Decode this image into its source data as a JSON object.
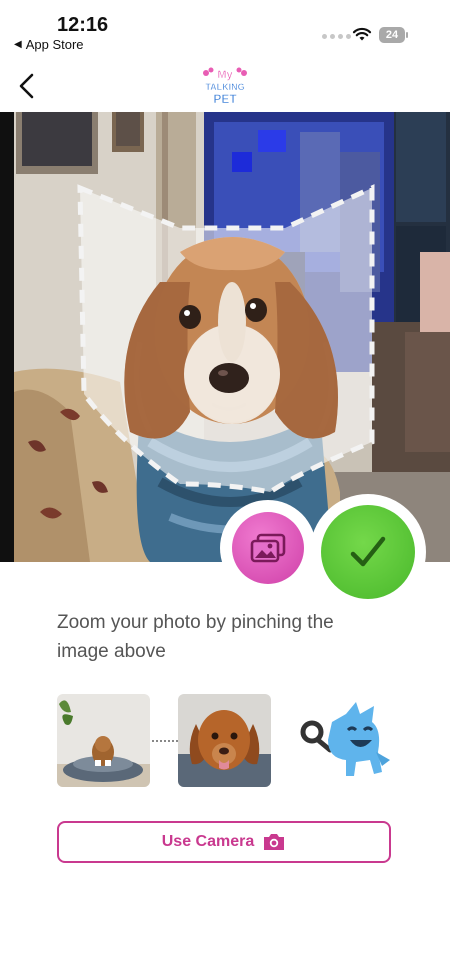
{
  "status_bar": {
    "time": "12:16",
    "back_app_label": "App Store",
    "battery_level": "24"
  },
  "nav": {
    "logo_text_line1": "My",
    "logo_text_line2": "TALKING",
    "logo_text_line3": "PET"
  },
  "editor": {
    "gallery_icon": "photo-gallery-icon",
    "confirm_icon": "checkmark-icon"
  },
  "instructions": {
    "text": "Zoom your photo by pinching the image above"
  },
  "actions": {
    "use_camera_label": "Use Camera",
    "camera_icon": "camera-icon"
  },
  "colors": {
    "accent": "#c9398f",
    "confirm_green": "#55c236",
    "gallery_pink": "#e05cbf"
  }
}
